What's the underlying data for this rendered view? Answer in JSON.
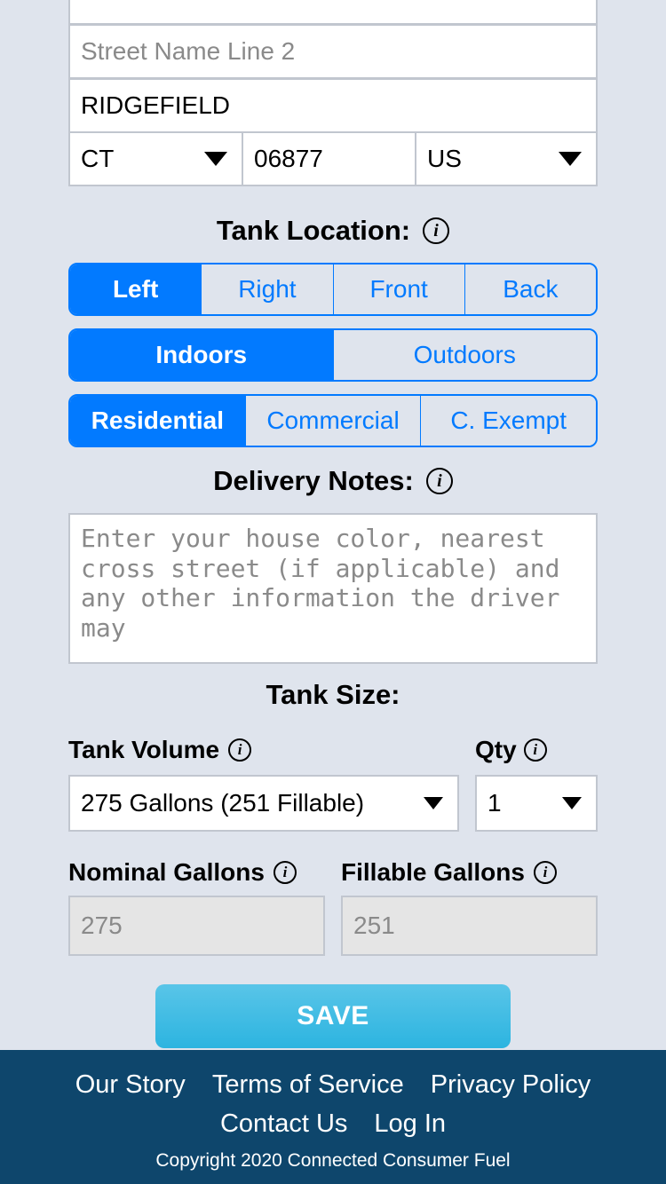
{
  "address": {
    "street1_value": "",
    "street2_placeholder": "Street Name Line 2",
    "street2_value": "",
    "city": "RIDGEFIELD",
    "state": "CT",
    "zip": "06877",
    "country": "US"
  },
  "tank_location": {
    "heading": "Tank Location:",
    "row1": [
      "Left",
      "Right",
      "Front",
      "Back"
    ],
    "row1_selected": 0,
    "row2": [
      "Indoors",
      "Outdoors"
    ],
    "row2_selected": 0,
    "row3": [
      "Residential",
      "Commercial",
      "C. Exempt"
    ],
    "row3_selected": 0
  },
  "delivery_notes": {
    "heading": "Delivery Notes:",
    "placeholder": "Enter your house color, nearest cross street (if applicable) and any other information the driver may ",
    "value": ""
  },
  "tank_size": {
    "heading": "Tank Size:",
    "volume_label": "Tank Volume",
    "qty_label": "Qty",
    "volume_value": "275 Gallons (251 Fillable)",
    "qty_value": "1",
    "nominal_label": "Nominal Gallons",
    "fillable_label": "Fillable Gallons",
    "nominal_value": "275",
    "fillable_value": "251"
  },
  "save_label": "SAVE",
  "footer": {
    "links": [
      "Our Story",
      "Terms of Service",
      "Privacy Policy",
      "Contact Us",
      "Log In"
    ],
    "copyright": "Copyright 2020 Connected Consumer Fuel"
  }
}
